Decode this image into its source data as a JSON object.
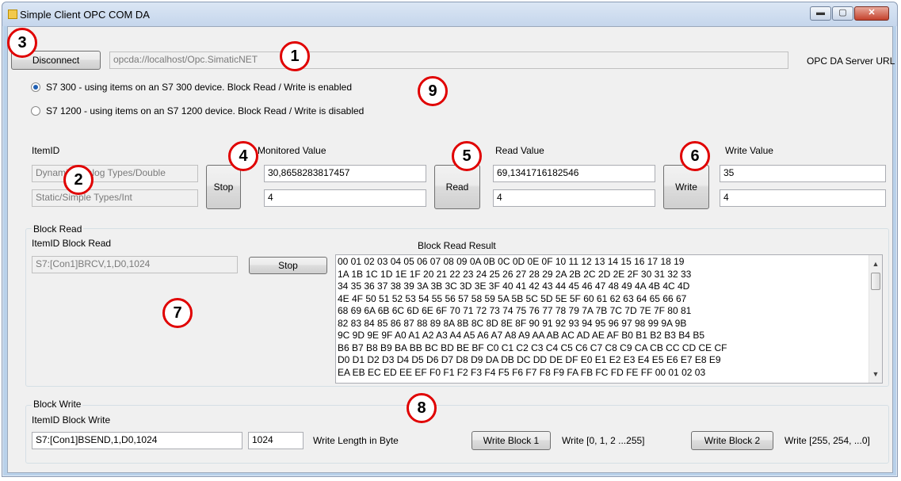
{
  "window": {
    "title": "Simple Client OPC COM DA",
    "controls": {
      "minimize": "▬",
      "maximize": "▢",
      "close": "✕"
    }
  },
  "connection": {
    "disconnect_label": "Disconnect",
    "server_url": "opcda://localhost/Opc.SimaticNET",
    "server_url_label": "OPC DA Server URL"
  },
  "device_options": [
    {
      "label": "S7 300 - using items on an S7 300 device. Block Read / Write is enabled",
      "selected": true
    },
    {
      "label": "S7 1200 - using items on an S7 1200 device. Block Read / Write is disabled",
      "selected": false
    }
  ],
  "items": {
    "itemid_header": "ItemID",
    "monitored_header": "Monitored Value",
    "read_header": "Read Value",
    "write_header": "Write Value",
    "ids": [
      "Dynamic/Analog Types/Double",
      "Static/Simple Types/Int"
    ],
    "monitored_values": [
      "30,8658283817457",
      "4"
    ],
    "read_values": [
      "69,1341716182546",
      "4"
    ],
    "write_values": [
      "35",
      "4"
    ],
    "stop_label": "Stop",
    "read_label": "Read",
    "write_label": "Write"
  },
  "block_read": {
    "group_label": "Block Read",
    "itemid_label": "ItemID Block Read",
    "itemid_value": "S7:[Con1]BRCV,1,D0,1024",
    "stop_label": "Stop",
    "result_label": "Block Read Result",
    "result_lines": [
      "00 01 02 03 04 05 06 07 08 09 0A 0B 0C 0D 0E 0F 10 11 12 13 14 15 16 17 18 19",
      "1A 1B 1C 1D 1E 1F 20 21 22 23 24 25 26 27 28 29 2A 2B 2C 2D 2E 2F 30 31 32 33",
      "34 35 36 37 38 39 3A 3B 3C 3D 3E 3F 40 41 42 43 44 45 46 47 48 49 4A 4B 4C 4D",
      "4E 4F 50 51 52 53 54 55 56 57 58 59 5A 5B 5C 5D 5E 5F 60 61 62 63 64 65 66 67",
      "68 69 6A 6B 6C 6D 6E 6F 70 71 72 73 74 75 76 77 78 79 7A 7B 7C 7D 7E 7F 80 81",
      "82 83 84 85 86 87 88 89 8A 8B 8C 8D 8E 8F 90 91 92 93 94 95 96 97 98 99 9A 9B",
      "9C 9D 9E 9F A0 A1 A2 A3 A4 A5 A6 A7 A8 A9 AA AB AC AD AE AF B0 B1 B2 B3 B4 B5",
      "B6 B7 B8 B9 BA BB BC BD BE BF C0 C1 C2 C3 C4 C5 C6 C7 C8 C9 CA CB CC CD CE CF",
      "D0 D1 D2 D3 D4 D5 D6 D7 D8 D9 DA DB DC DD DE DF E0 E1 E2 E3 E4 E5 E6 E7 E8 E9",
      "EA EB EC ED EE EF F0 F1 F2 F3 F4 F5 F6 F7 F8 F9 FA FB FC FD FE FF 00 01 02 03"
    ],
    "scroll_up": "▲",
    "scroll_down": "▼"
  },
  "block_write": {
    "group_label": "Block Write",
    "itemid_label": "ItemID Block Write",
    "itemid_value": "S7:[Con1]BSEND,1,D0,1024",
    "length_value": "1024",
    "length_label": "Write Length in Byte",
    "block1_label": "Write Block 1",
    "block1_desc": "Write [0, 1, 2 ...255]",
    "block2_label": "Write Block 2",
    "block2_desc": "Write [255, 254, ...0]"
  },
  "callouts": [
    "1",
    "2",
    "3",
    "4",
    "5",
    "6",
    "7",
    "8",
    "9"
  ],
  "colors": {
    "callout_border": "#e00000",
    "title_bar": "#c5d6ec",
    "client_bg": "#f0f0f0"
  }
}
